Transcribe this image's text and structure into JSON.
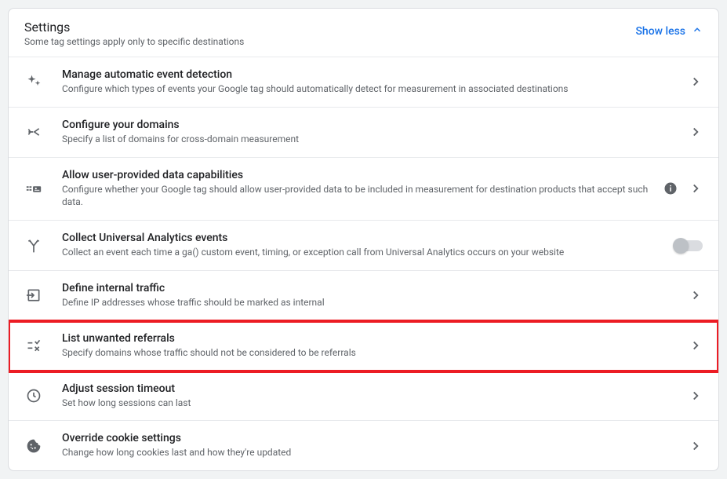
{
  "header": {
    "title": "Settings",
    "subtitle": "Some tag settings apply only to specific destinations",
    "toggle_label": "Show less"
  },
  "rows": [
    {
      "title": "Manage automatic event detection",
      "desc": "Configure which types of events your Google tag should automatically detect for measurement in associated destinations"
    },
    {
      "title": "Configure your domains",
      "desc": "Specify a list of domains for cross-domain measurement"
    },
    {
      "title": "Allow user-provided data capabilities",
      "desc": "Configure whether your Google tag should allow user-provided data to be included in measurement for destination products that accept such data."
    },
    {
      "title": "Collect Universal Analytics events",
      "desc": "Collect an event each time a ga() custom event, timing, or exception call from Universal Analytics occurs on your website"
    },
    {
      "title": "Define internal traffic",
      "desc": "Define IP addresses whose traffic should be marked as internal"
    },
    {
      "title": "List unwanted referrals",
      "desc": "Specify domains whose traffic should not be considered to be referrals"
    },
    {
      "title": "Adjust session timeout",
      "desc": "Set how long sessions can last"
    },
    {
      "title": "Override cookie settings",
      "desc": "Change how long cookies last and how they're updated"
    }
  ]
}
